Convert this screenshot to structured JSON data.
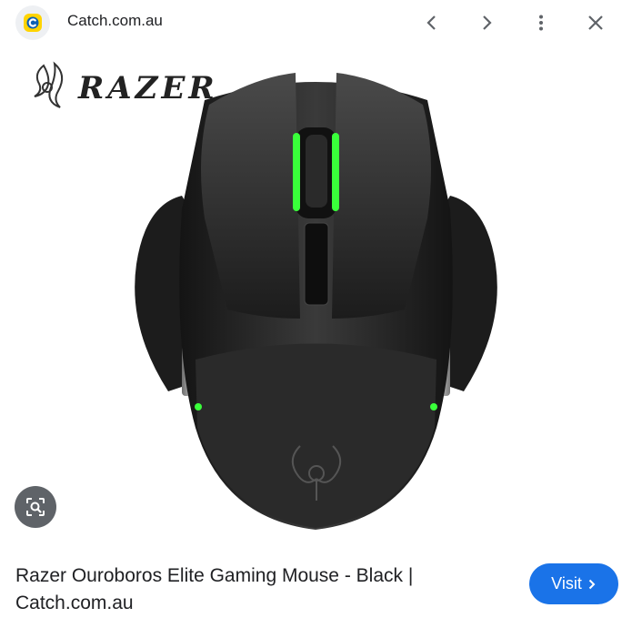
{
  "header": {
    "site_name": "Catch.com.au",
    "icons": {
      "site": "catch-logo-icon",
      "back": "chevron-left-icon",
      "forward": "chevron-right-icon",
      "menu": "more-vert-icon",
      "close": "close-icon"
    }
  },
  "image": {
    "brand_logo_text": "RAZER",
    "product": "Razer Ouroboros gaming mouse",
    "accent_color": "#39ff3a"
  },
  "lens": {
    "icon": "lens-search-icon"
  },
  "caption": {
    "line1": "Razer Ouroboros Elite Gaming Mouse - Black |",
    "line2": "Catch.com.au"
  },
  "visit": {
    "label": "Visit",
    "icon": "chevron-right-icon",
    "color": "#1a73e8"
  }
}
